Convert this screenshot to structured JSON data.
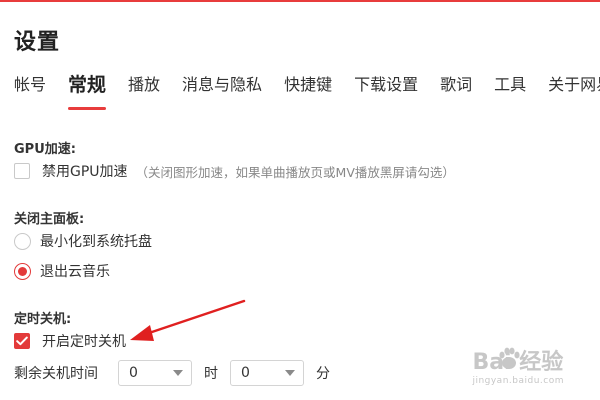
{
  "window": {
    "title": "设置",
    "accent_color": "#e83c3c"
  },
  "tabs": [
    {
      "label": "帐号",
      "active": false
    },
    {
      "label": "常规",
      "active": true
    },
    {
      "label": "播放",
      "active": false
    },
    {
      "label": "消息与隐私",
      "active": false
    },
    {
      "label": "快捷键",
      "active": false
    },
    {
      "label": "下载设置",
      "active": false
    },
    {
      "label": "歌词",
      "active": false
    },
    {
      "label": "工具",
      "active": false
    },
    {
      "label": "关于网易",
      "active": false
    }
  ],
  "gpu": {
    "section_label": "GPU加速:",
    "checkbox_label": "禁用GPU加速",
    "checked": false,
    "hint": "（关闭图形加速，如果单曲播放页或MV播放黑屏请勾选）"
  },
  "close_panel": {
    "section_label": "关闭主面板:",
    "options": [
      {
        "label": "最小化到系统托盘",
        "selected": false
      },
      {
        "label": "退出云音乐",
        "selected": true
      }
    ]
  },
  "shutdown": {
    "section_label": "定时关机:",
    "checkbox_label": "开启定时关机",
    "checked": true,
    "remaining_label": "剩余关机时间",
    "hours_value": "0",
    "hours_unit": "时",
    "minutes_value": "0",
    "minutes_unit": "分"
  },
  "annotation": {
    "arrow_color": "#e02020",
    "icon": "red-arrow-icon"
  },
  "watermark": {
    "main": "Bai  经验",
    "sub": "jingyan.baidu.com",
    "icon": "baidu-paw-icon"
  }
}
